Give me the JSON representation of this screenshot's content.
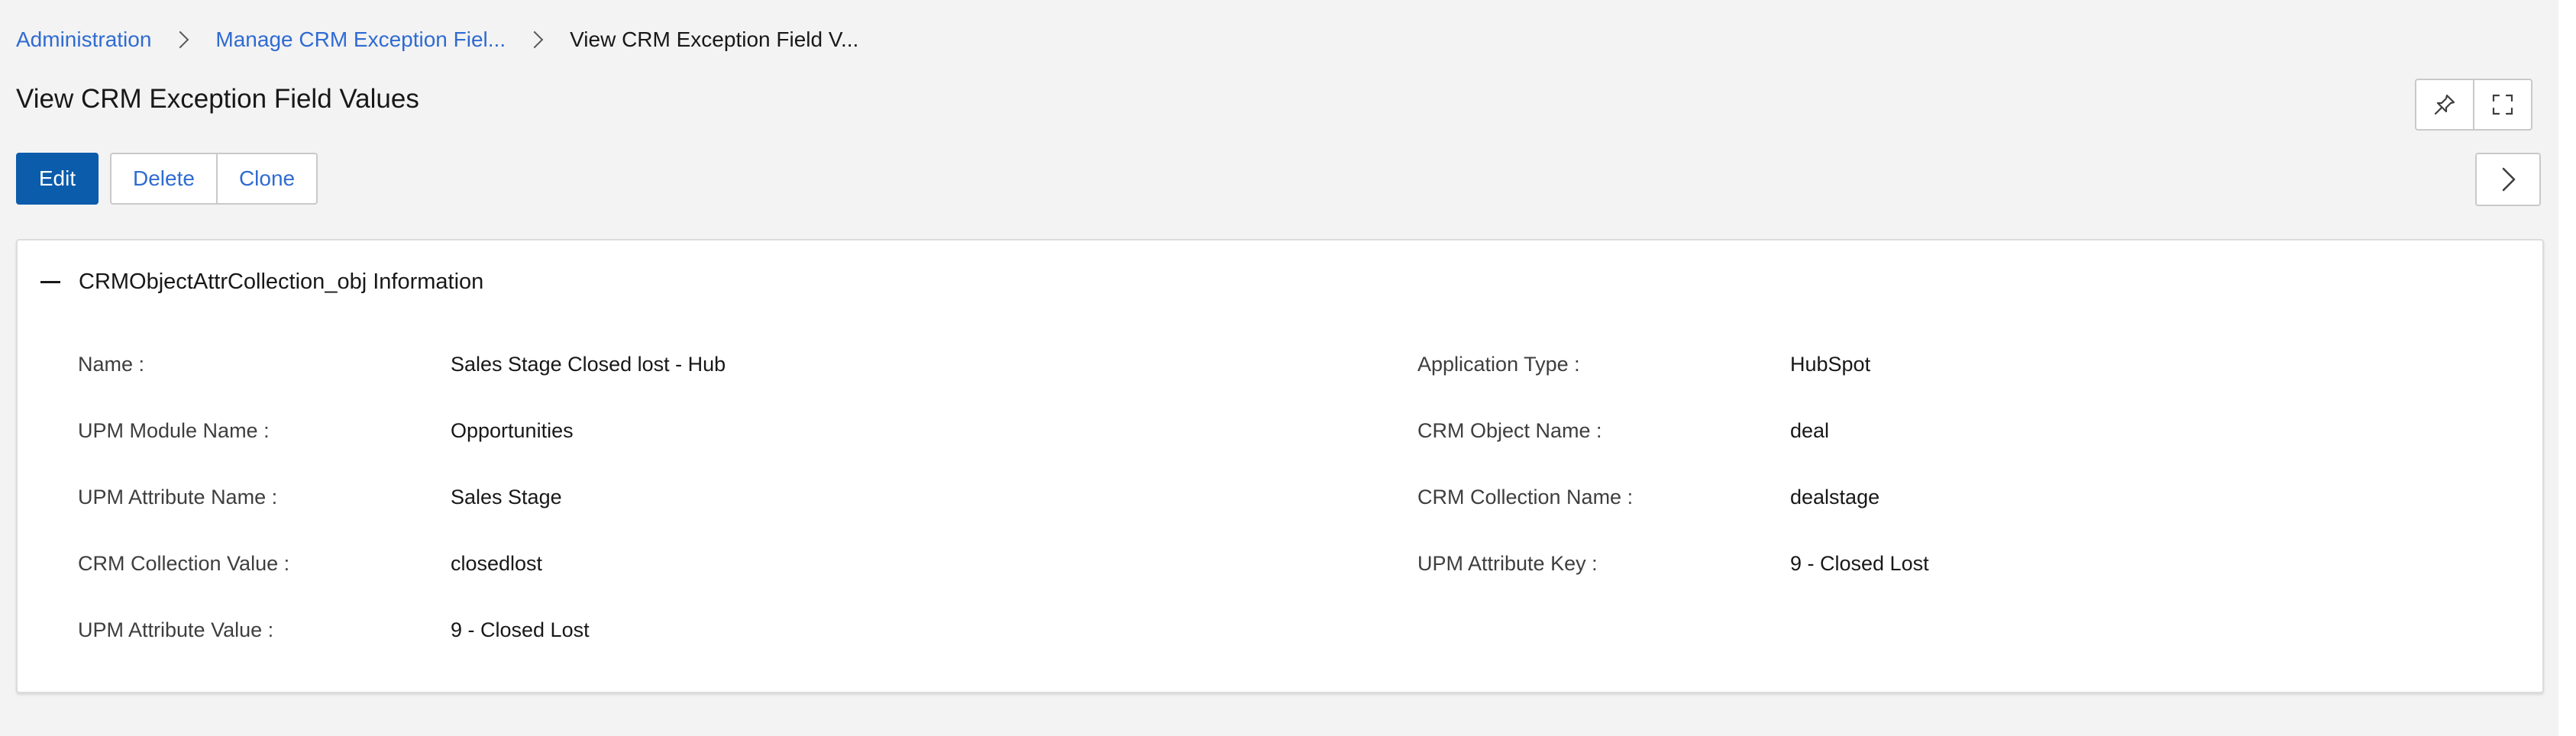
{
  "breadcrumb": {
    "items": [
      "Administration",
      "Manage CRM Exception Fiel...",
      "View CRM Exception Field V..."
    ]
  },
  "page": {
    "title": "View CRM Exception Field Values"
  },
  "header_icons": [
    "pin-icon",
    "expand-icon"
  ],
  "actions": {
    "edit_label": "Edit",
    "delete_label": "Delete",
    "clone_label": "Clone",
    "next_icon": "chevron-right-icon"
  },
  "section": {
    "title": "CRMObjectAttrCollection_obj Information",
    "toggle_icon": "collapse-icon",
    "fields": [
      {
        "label": "Name :",
        "value": "Sales Stage Closed lost - Hub"
      },
      {
        "label": "Application Type :",
        "value": "HubSpot"
      },
      {
        "label": "UPM Module Name :",
        "value": "Opportunities"
      },
      {
        "label": "CRM Object Name :",
        "value": "deal"
      },
      {
        "label": "UPM Attribute Name :",
        "value": "Sales Stage"
      },
      {
        "label": "CRM Collection Name :",
        "value": "dealstage"
      },
      {
        "label": "CRM Collection Value :",
        "value": "closedlost"
      },
      {
        "label": "UPM Attribute Key :",
        "value": "9 - Closed Lost"
      },
      {
        "label": "UPM Attribute Value :",
        "value": "9 - Closed Lost"
      }
    ]
  },
  "colors": {
    "primary": "#0b5cab",
    "link": "#2f6bd1",
    "background": "#f3f3f3"
  }
}
